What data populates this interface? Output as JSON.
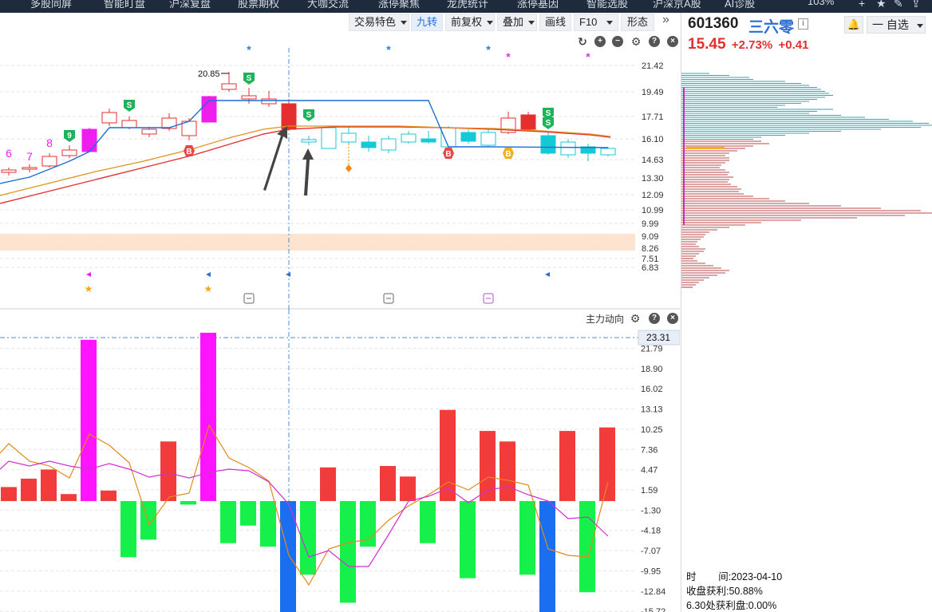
{
  "topnav": {
    "items": [
      "多股同屏",
      "智能盯盘",
      "沪深复盘",
      "股票期权",
      "大咖交流",
      "涨停聚焦",
      "龙虎统计",
      "涨停基因",
      "智能选股",
      "沪深京A股",
      "AI诊股"
    ],
    "zoom": "103%"
  },
  "toolbar": {
    "trade_color": "交易特色",
    "nine_turn": "九转",
    "pre_adjust": "前复权",
    "overlay": "叠加",
    "draw_line": "画线",
    "f10": "F10",
    "pattern": "形态",
    "more": "»"
  },
  "stock": {
    "code": "601360",
    "name": "三六零",
    "info_icon": "i",
    "price": "15.45",
    "pct": "+2.73%",
    "change": "+0.41",
    "fav_label": "一 自选"
  },
  "main_chart": {
    "price_labels": [
      "21.42",
      "19.49",
      "17.71",
      "16.10",
      "14.63",
      "13.30",
      "12.09",
      "10.99",
      "9.99",
      "9.09",
      "8.26",
      "7.51",
      "6.83"
    ],
    "high_label": "20.85",
    "nine_turn_counts": [
      "6",
      "7",
      "8"
    ],
    "nine_turn_badge": "9",
    "sell_badge": "S",
    "buy_badge": "B"
  },
  "sub_chart": {
    "title": "主力动向",
    "y_labels": [
      "21.79",
      "18.90",
      "16.02",
      "13.13",
      "10.25",
      "7.36",
      "4.47",
      "1.59",
      "-1.30",
      "-4.18",
      "-7.07",
      "-9.95",
      "-12.84",
      "-15.72"
    ],
    "cursor_value": "23.31"
  },
  "chip_info": {
    "time_label": "时        间:2023-04-10",
    "profit_label": "收盘获利:50.88%",
    "profit_at": "6.30处获利盘:0.00%"
  },
  "chart_data": {
    "type": "candlestick",
    "title": "",
    "subchart": {
      "type": "bar",
      "title": "主力动向",
      "values": [
        2.0,
        3.2,
        4.5,
        1.0,
        23.0,
        1.5,
        -8.0,
        -5.5,
        8.5,
        -0.5,
        24.0,
        -6.0,
        -3.5,
        -6.5,
        -16.0,
        -10.5,
        4.8,
        -14.5,
        -6.5,
        5.0,
        3.5,
        -6.0,
        13.0,
        -11.0,
        10.0,
        8.5,
        -10.5,
        -16.0,
        10.0,
        -13.0,
        10.5
      ]
    }
  }
}
